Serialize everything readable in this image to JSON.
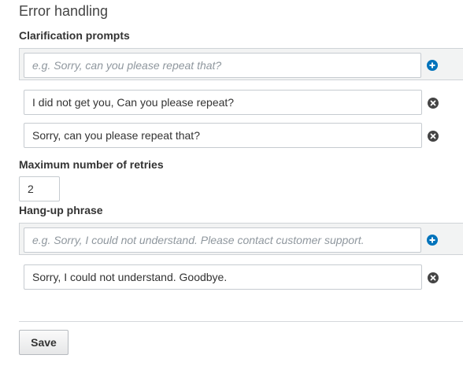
{
  "section_title": "Error handling",
  "clarification": {
    "label": "Clarification prompts",
    "new_placeholder": "e.g. Sorry, can you please repeat that?",
    "prompts": [
      "I did not get you, Can you please repeat?",
      "Sorry, can you please repeat that?"
    ]
  },
  "retries": {
    "label": "Maximum number of retries",
    "value": "2"
  },
  "hangup": {
    "label": "Hang-up phrase",
    "new_placeholder": "e.g. Sorry, I could not understand. Please contact customer support.",
    "phrases": [
      "Sorry, I could not understand. Goodbye."
    ]
  },
  "actions": {
    "save_label": "Save"
  },
  "icons": {
    "add": "plus-circle-icon",
    "remove": "x-circle-icon"
  },
  "colors": {
    "add_icon": "#0073bb",
    "remove_icon": "#444444"
  }
}
